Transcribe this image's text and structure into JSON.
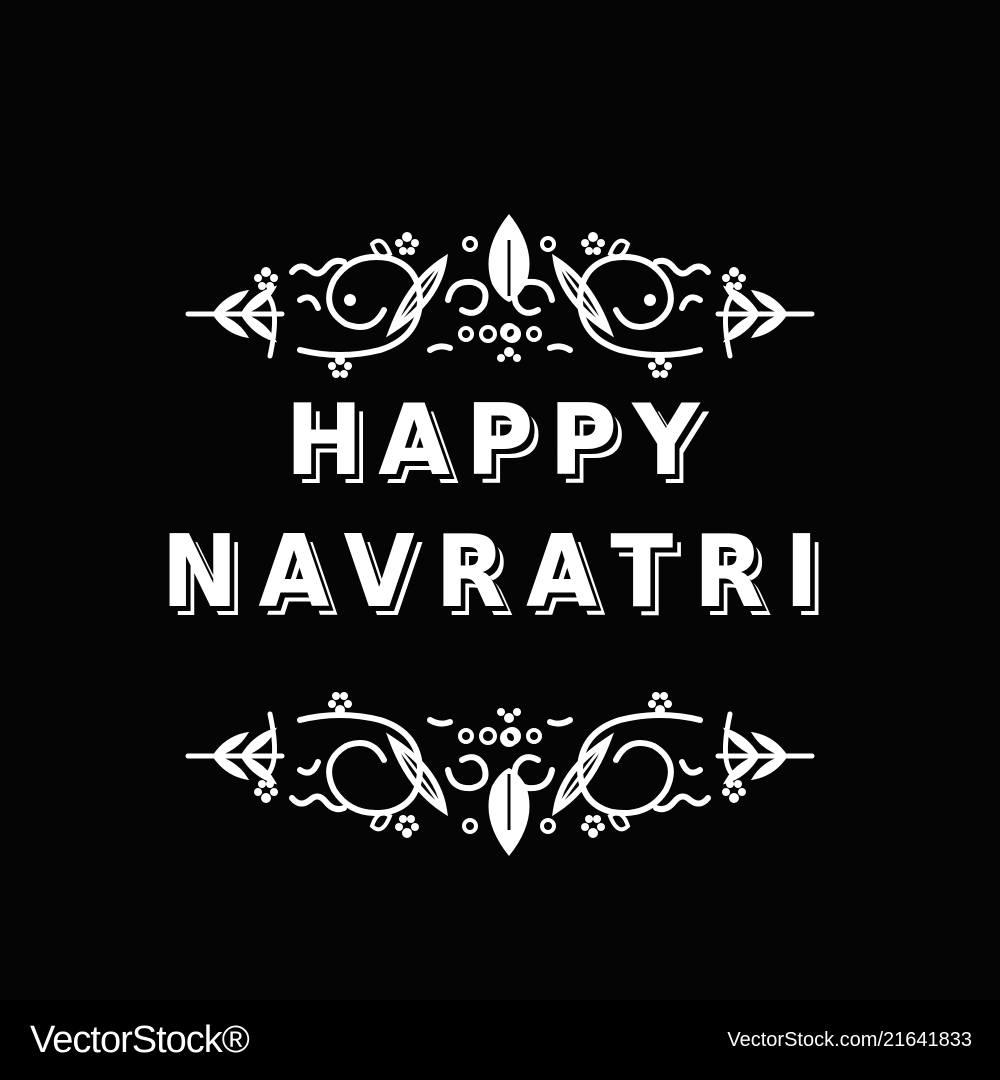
{
  "greeting": {
    "line1": "HAPPY",
    "line2": "NAVRATRI"
  },
  "decoration": {
    "top_icon": "floral-ornament-icon",
    "bottom_icon": "floral-ornament-icon",
    "color": "#ffffff",
    "background": "#050505"
  },
  "watermark": {
    "logo": "VectorStock®",
    "image_id": "VectorStock.com/21641833"
  }
}
